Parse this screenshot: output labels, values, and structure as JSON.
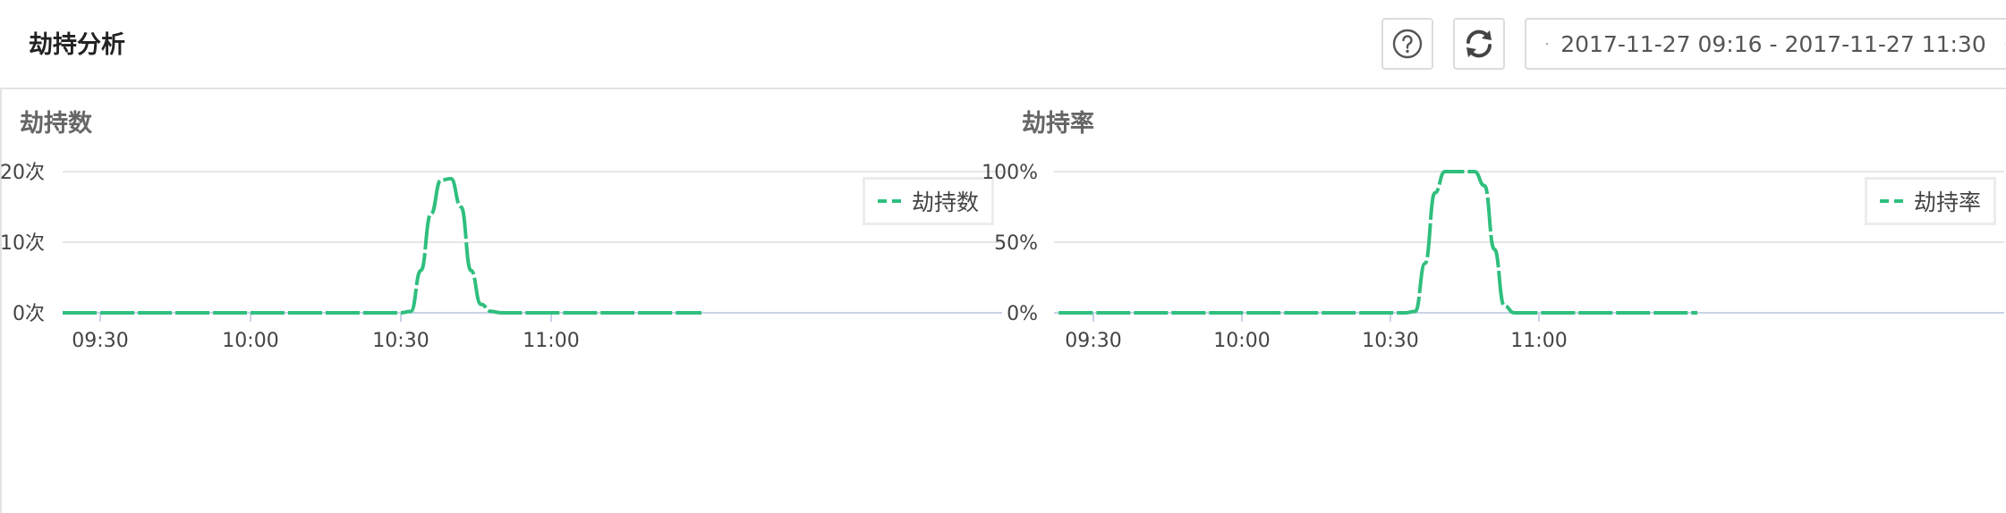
{
  "header": {
    "title": "劫持分析",
    "date_range": "2017-11-27 09:16 - 2017-11-27 11:30"
  },
  "icons": {
    "help": "question-circle-icon",
    "refresh": "refresh-icon",
    "clock": "clock-icon",
    "chevron": "chevron-down-icon"
  },
  "colors": {
    "series": "#2fbf7e",
    "grid": "#e6e6e6"
  },
  "panels": [
    {
      "title": "劫持数",
      "legend": "劫持数",
      "chart_data": {
        "type": "line",
        "y_ticks": [
          "0次",
          "10次",
          "20次"
        ],
        "y_tick_values": [
          0,
          10,
          20
        ],
        "ylim": [
          0,
          20
        ],
        "x_ticks": [
          "09:30",
          "10:00",
          "10:30",
          "11:00"
        ],
        "x_tick_minutes": [
          570,
          600,
          630,
          660
        ],
        "xlim_minutes": [
          560,
          690
        ],
        "series": [
          {
            "name": "劫持数",
            "x_minutes": [
              560,
              630,
              632,
              634,
              636,
              638,
              640,
              642,
              644,
              646,
              648,
              650,
              690
            ],
            "values": [
              0,
              0,
              0.2,
              6,
              14,
              18.8,
              19,
              15,
              6,
              1.2,
              0.2,
              0,
              0
            ]
          }
        ]
      }
    },
    {
      "title": "劫持率",
      "legend": "劫持率",
      "chart_data": {
        "type": "line",
        "y_ticks": [
          "0%",
          "50%",
          "100%"
        ],
        "y_tick_values": [
          0,
          50,
          100
        ],
        "ylim": [
          0,
          100
        ],
        "x_ticks": [
          "09:30",
          "10:00",
          "10:30",
          "11:00"
        ],
        "x_tick_minutes": [
          570,
          600,
          630,
          660
        ],
        "xlim_minutes": [
          563,
          692
        ],
        "series": [
          {
            "name": "劫持率",
            "x_minutes": [
              563,
              633,
              635,
              637,
              639,
              641,
              643,
              645,
              647,
              649,
              651,
              653,
              655,
              692
            ],
            "values": [
              0,
              0,
              1,
              35,
              85,
              100,
              100,
              100,
              100,
              90,
              45,
              5,
              0,
              0
            ]
          }
        ]
      }
    }
  ]
}
